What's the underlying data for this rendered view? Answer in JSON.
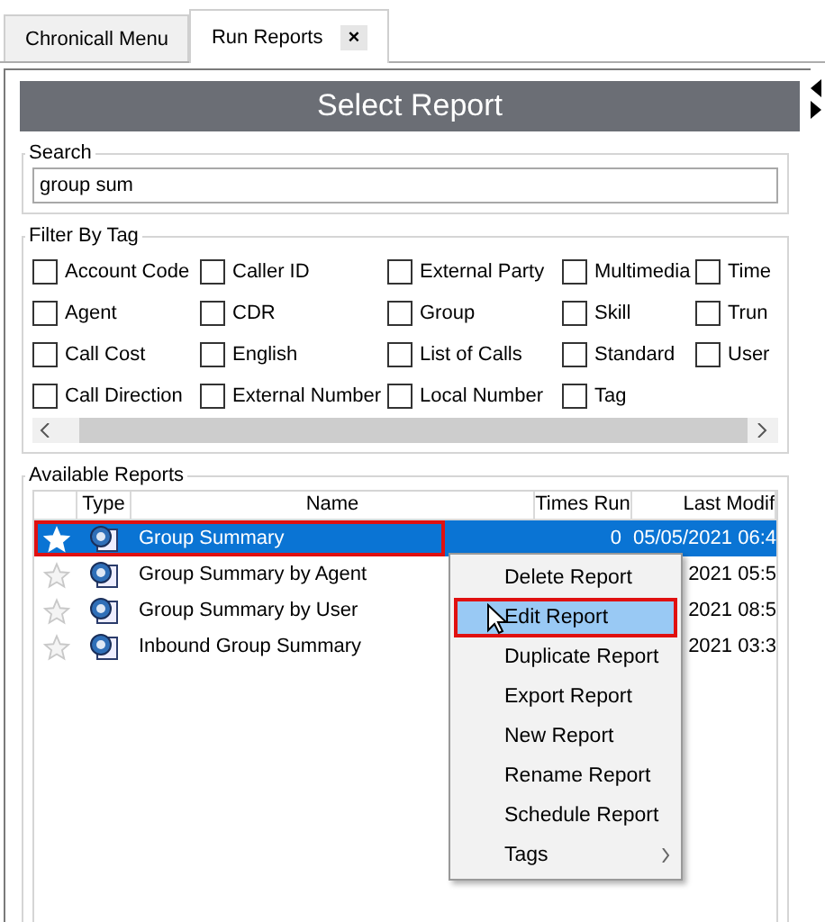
{
  "tabs": [
    {
      "label": "Chronicall Menu",
      "selected": false,
      "closable": false
    },
    {
      "label": "Run Reports",
      "selected": true,
      "closable": true,
      "close_glyph": "×"
    }
  ],
  "header": {
    "title": "Select Report"
  },
  "search": {
    "legend": "Search",
    "value": "group sum"
  },
  "filter": {
    "legend": "Filter By Tag",
    "tags": [
      {
        "label": "Account Code",
        "checked": false
      },
      {
        "label": "Caller ID",
        "checked": false
      },
      {
        "label": "External Party",
        "checked": false
      },
      {
        "label": "Multimedia",
        "checked": false
      },
      {
        "label": "Time",
        "checked": false
      },
      {
        "label": "Agent",
        "checked": false
      },
      {
        "label": "CDR",
        "checked": false
      },
      {
        "label": "Group",
        "checked": false
      },
      {
        "label": "Skill",
        "checked": false
      },
      {
        "label": "Trun",
        "checked": false
      },
      {
        "label": "Call Cost",
        "checked": false
      },
      {
        "label": "English",
        "checked": false
      },
      {
        "label": "List of Calls",
        "checked": false
      },
      {
        "label": "Standard",
        "checked": false
      },
      {
        "label": "User",
        "checked": false
      },
      {
        "label": "Call Direction",
        "checked": false
      },
      {
        "label": "External Number",
        "checked": false
      },
      {
        "label": "Local Number",
        "checked": false
      },
      {
        "label": "Tag",
        "checked": false
      }
    ]
  },
  "reports": {
    "legend": "Available Reports",
    "columns": [
      "Type",
      "Name",
      "Times Run",
      "Last Modif"
    ],
    "rows": [
      {
        "name": "Group Summary",
        "times_run": "0",
        "last_modified": "05/05/2021 06:4",
        "selected": true
      },
      {
        "name": "Group Summary by Agent",
        "last_modified": "2021 05:5",
        "selected": false
      },
      {
        "name": "Group Summary by User",
        "last_modified": "2021 08:5",
        "selected": false
      },
      {
        "name": "Inbound Group Summary",
        "last_modified": "2021 03:3",
        "selected": false
      }
    ]
  },
  "context_menu": {
    "items": [
      {
        "label": "Delete Report",
        "selected": false,
        "submenu": false
      },
      {
        "label": "Edit Report",
        "selected": true,
        "submenu": false
      },
      {
        "label": "Duplicate Report",
        "selected": false,
        "submenu": false
      },
      {
        "label": "Export Report",
        "selected": false,
        "submenu": false
      },
      {
        "label": "New Report",
        "selected": false,
        "submenu": false
      },
      {
        "label": "Rename Report",
        "selected": false,
        "submenu": false
      },
      {
        "label": "Schedule Report",
        "selected": false,
        "submenu": false
      },
      {
        "label": "Tags",
        "selected": false,
        "submenu": true
      }
    ]
  }
}
